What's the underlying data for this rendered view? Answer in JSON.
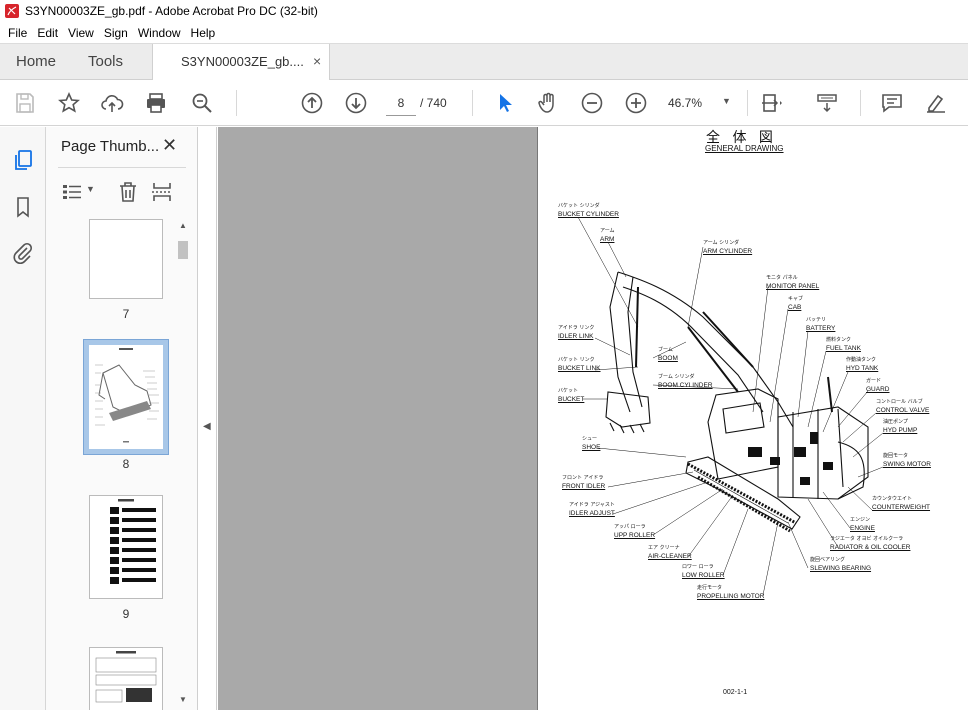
{
  "window": {
    "title": "S3YN00003ZE_gb.pdf - Adobe Acrobat Pro DC (32-bit)"
  },
  "menu": [
    "File",
    "Edit",
    "View",
    "Sign",
    "Window",
    "Help"
  ],
  "tabs": {
    "home": "Home",
    "tools": "Tools",
    "document": "S3YN00003ZE_gb....",
    "close": "×"
  },
  "toolbar": {
    "page_current": "8",
    "page_total": "/ 740",
    "zoom": "46.7%"
  },
  "panel": {
    "title": "Page Thumb...",
    "close": "✕",
    "thumbnails": [
      {
        "number": "7"
      },
      {
        "number": "8",
        "selected": true
      },
      {
        "number": "9"
      }
    ]
  },
  "document": {
    "title_jp": "全 体 図",
    "title_en": "GENERAL DRAWING",
    "page_code": "002-1-1",
    "labels": [
      {
        "jp": "バケット シリンダ",
        "en": "BUCKET CYLINDER"
      },
      {
        "jp": "アーム",
        "en": "ARM"
      },
      {
        "jp": "アーム シリンダ",
        "en": "ARM CYLINDER"
      },
      {
        "jp": "モニタ パネル",
        "en": "MONITOR PANEL"
      },
      {
        "jp": "キャブ",
        "en": "CAB"
      },
      {
        "jp": "バッテリ",
        "en": "BATTERY"
      },
      {
        "jp": "燃料タンク",
        "en": "FUEL TANK"
      },
      {
        "jp": "作動油タンク",
        "en": "HYD TANK"
      },
      {
        "jp": "ガード",
        "en": "GUARD"
      },
      {
        "jp": "コントロール バルブ",
        "en": "CONTROL VALVE"
      },
      {
        "jp": "油圧ポンプ",
        "en": "HYD PUMP"
      },
      {
        "jp": "旋回モータ",
        "en": "SWING MOTOR"
      },
      {
        "jp": "カウンタウエイト",
        "en": "COUNTERWEIGHT"
      },
      {
        "jp": "エンジン",
        "en": "ENGINE"
      },
      {
        "jp": "ラジエータ オヨビ オイルクーラ",
        "en": "RADIATOR & OIL COOLER"
      },
      {
        "jp": "旋回ベアリング",
        "en": "SLEWING BEARING"
      },
      {
        "jp": "アイドラ リンク",
        "en": "IDLER LINK"
      },
      {
        "jp": "バケット リンク",
        "en": "BUCKET LINK"
      },
      {
        "jp": "ブーム",
        "en": "BOOM"
      },
      {
        "jp": "ブーム シリンダ",
        "en": "BOOM CYLINDER"
      },
      {
        "jp": "バケット",
        "en": "BUCKET"
      },
      {
        "jp": "シュー",
        "en": "SHOE"
      },
      {
        "jp": "フロント アイドラ",
        "en": "FRONT IDLER"
      },
      {
        "jp": "アイドラ アジャスト",
        "en": "IDLER ADJUST"
      },
      {
        "jp": "アッパ ローラ",
        "en": "UPP ROLLER"
      },
      {
        "jp": "エア クリーナ",
        "en": "AIR-CLEANER"
      },
      {
        "jp": "ロワー ローラ",
        "en": "LOW ROLLER"
      },
      {
        "jp": "走行モータ",
        "en": "PROPELLING MOTOR"
      }
    ]
  }
}
